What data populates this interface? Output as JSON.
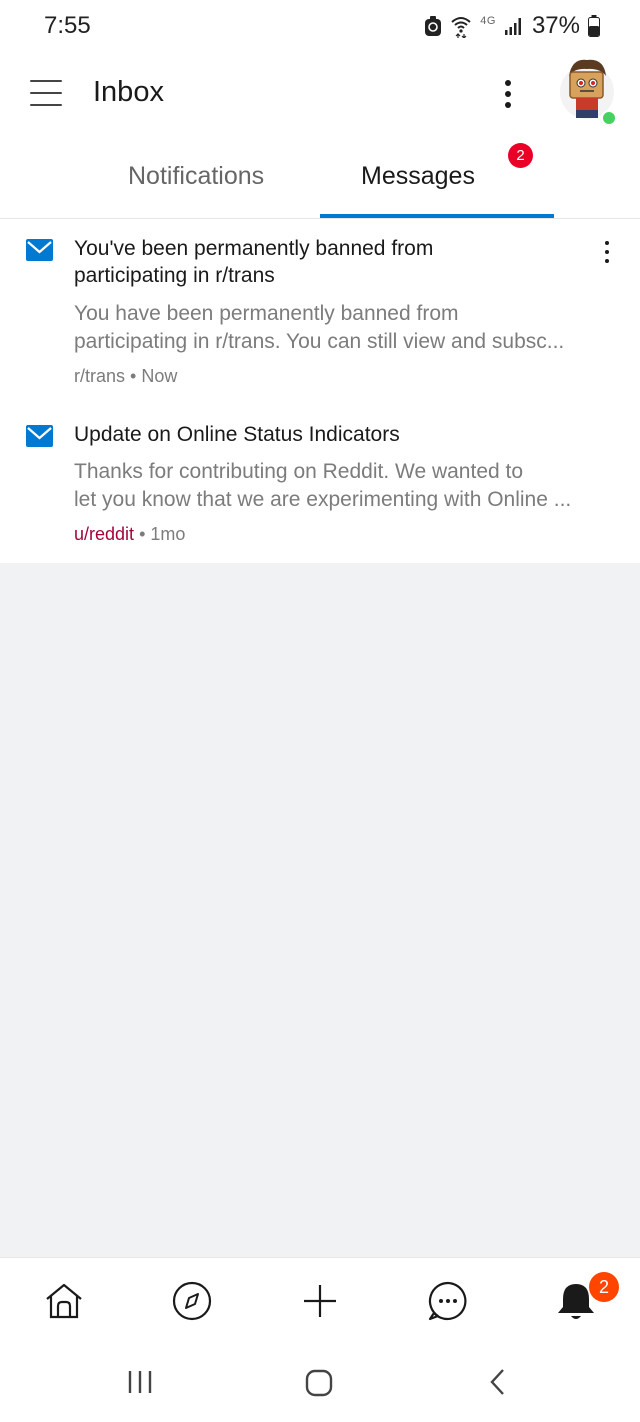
{
  "status_bar": {
    "time": "7:55",
    "network_label": "4G",
    "battery": "37%"
  },
  "header": {
    "title": "Inbox"
  },
  "tabs": [
    {
      "label": "Notifications",
      "active": false
    },
    {
      "label": "Messages",
      "active": true
    }
  ],
  "messages_badge": "2",
  "messages": [
    {
      "title": "You've been permanently banned from participating in r/trans",
      "title_line1": "You've been permanently banned from",
      "title_line2": "participating in r/trans",
      "body_line1": "You have been permanently banned from",
      "body_line2": "participating in r/trans. You can still view and subsc...",
      "source": "r/trans",
      "separator": "•",
      "time": "Now"
    },
    {
      "title": "Update on Online Status Indicators",
      "body_line1": "Thanks for contributing on Reddit. We wanted to",
      "body_line2": "let you know that we are experimenting with Online ...",
      "source": "u/reddit",
      "separator": "•",
      "time": "1mo"
    }
  ],
  "bottom_nav": {
    "items": [
      "home-icon",
      "discover-icon",
      "create-icon",
      "chat-icon",
      "inbox-bell-icon"
    ],
    "inbox_badge": "2"
  },
  "colors": {
    "accent": "#0079d3",
    "badge_red": "#ea0027",
    "badge_orange": "#ff4500",
    "user_link": "#a5043a",
    "online": "#46d160",
    "empty_area": "#f1f2f4"
  }
}
